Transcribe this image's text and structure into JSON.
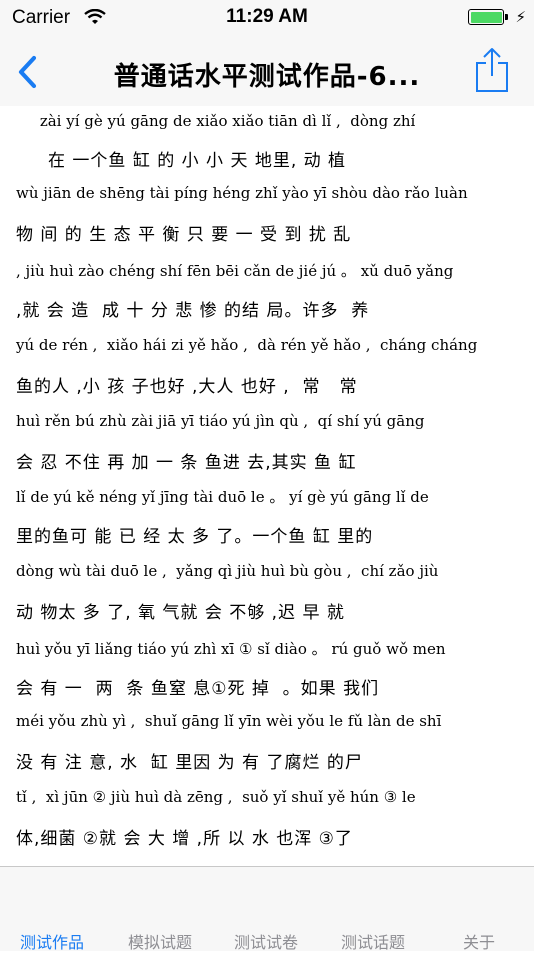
{
  "status": {
    "carrier": "Carrier",
    "time": "11:29 AM"
  },
  "nav": {
    "title": "普通话水平测试作品-6...",
    "back_icon": "chevron-left-icon",
    "share_icon": "share-icon",
    "accent": "#1a7cf2"
  },
  "content": {
    "lines": [
      {
        "type": "py",
        "text": "     zài yí gè yú gāng de xiǎo xiǎo tiān dì lǐ ,  dòng zhí"
      },
      {
        "type": "hz",
        "text": "     在 一个鱼 缸 的 小 小 天 地里, 动 植"
      },
      {
        "type": "py",
        "text": "wù jiān de shēng tài píng héng zhǐ yào yī shòu dào rǎo luàn"
      },
      {
        "type": "hz",
        "text": "物 间 的 生 态 平 衡 只 要 一 受 到 扰 乱"
      },
      {
        "type": "py",
        "text": ", jiù huì zào chéng shí fēn bēi cǎn de jié jú 。 xǔ duō yǎng"
      },
      {
        "type": "hz",
        "text": ",就 会 造  成 十 分 悲 惨 的结 局。许多  养"
      },
      {
        "type": "py",
        "text": "yú de rén ,  xiǎo hái zi yě hǎo ,  dà rén yě hǎo ,  cháng cháng"
      },
      {
        "type": "hz",
        "text": "鱼的人 ,小 孩 子也好 ,大人 也好 ,  常   常"
      },
      {
        "type": "py",
        "text": "huì rěn bú zhù zài jiā yī tiáo yú jìn qù ,  qí shí yú gāng"
      },
      {
        "type": "hz",
        "text": "会 忍 不住 再 加 一 条 鱼进 去,其实 鱼 缸"
      },
      {
        "type": "py",
        "text": "lǐ de yú kě néng yǐ jīng tài duō le 。 yí gè yú gāng lǐ de"
      },
      {
        "type": "hz",
        "text": "里的鱼可 能 已 经 太 多 了。一个鱼 缸 里的"
      },
      {
        "type": "py",
        "text": "dòng wù tài duō le ,  yǎng qì jiù huì bù gòu ,  chí zǎo jiù"
      },
      {
        "type": "hz",
        "text": "动 物太 多 了, 氧 气就 会 不够 ,迟 早 就"
      },
      {
        "type": "py",
        "text": "huì yǒu yī liǎng tiáo yú zhì xī ① sǐ diào 。 rú guǒ wǒ men"
      },
      {
        "type": "hz",
        "text": "会 有 一  两  条 鱼窒 息①死 掉  。如果 我们"
      },
      {
        "type": "py",
        "text": "méi yǒu zhù yì ,  shuǐ gāng lǐ yīn wèi yǒu le fǔ làn de shī"
      },
      {
        "type": "hz",
        "text": "没 有 注 意, 水  缸 里因 为 有 了腐烂 的尸"
      },
      {
        "type": "py",
        "text": "tǐ ,  xì jūn ② jiù huì dà zēng ,  suǒ yǐ shuǐ yě hún ③ le"
      },
      {
        "type": "hz",
        "text": "体,细菌 ②就 会 大 增 ,所 以 水 也浑 ③了"
      }
    ]
  },
  "tabs": [
    {
      "label": "测试作品",
      "active": true
    },
    {
      "label": "模拟试题",
      "active": false
    },
    {
      "label": "测试试卷",
      "active": false
    },
    {
      "label": "测试话题",
      "active": false
    },
    {
      "label": "关于",
      "active": false
    }
  ]
}
